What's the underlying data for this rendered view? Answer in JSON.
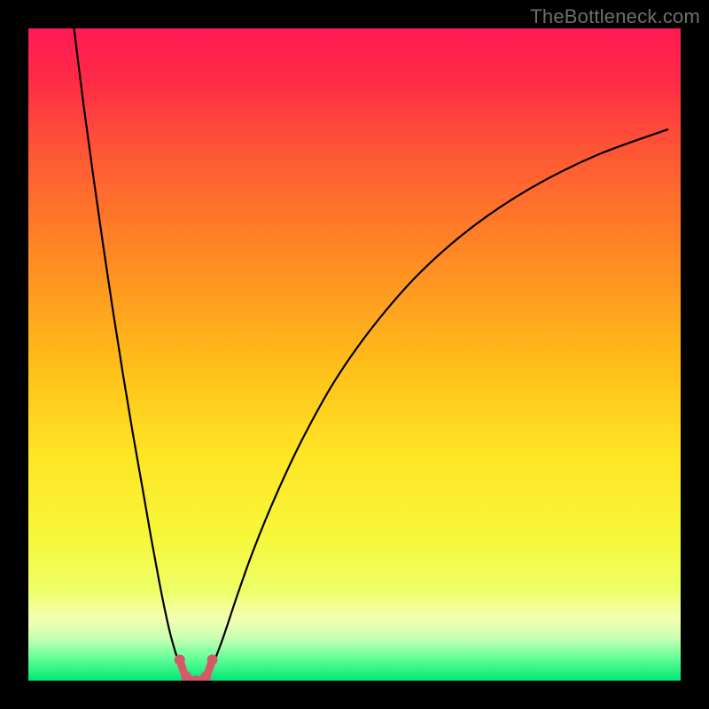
{
  "watermark": {
    "text": "TheBottleneck.com"
  },
  "chart_data": {
    "type": "line",
    "title": "",
    "xlabel": "",
    "ylabel": "",
    "xlim": [
      0,
      100
    ],
    "ylim": [
      0,
      100
    ],
    "grid": false,
    "legend": false,
    "background_gradient_stops": [
      {
        "offset": 0.0,
        "color": "#ff1a55"
      },
      {
        "offset": 0.08,
        "color": "#ff2b46"
      },
      {
        "offset": 0.2,
        "color": "#ff5a33"
      },
      {
        "offset": 0.35,
        "color": "#ff8a24"
      },
      {
        "offset": 0.5,
        "color": "#ffb91a"
      },
      {
        "offset": 0.65,
        "color": "#ffe423"
      },
      {
        "offset": 0.78,
        "color": "#f7f73a"
      },
      {
        "offset": 0.86,
        "color": "#eeff66"
      },
      {
        "offset": 0.905,
        "color": "#f4ffb0"
      },
      {
        "offset": 0.935,
        "color": "#c8ffb4"
      },
      {
        "offset": 0.965,
        "color": "#66ff99"
      },
      {
        "offset": 1.0,
        "color": "#00e874"
      }
    ],
    "series": [
      {
        "name": "left-branch",
        "stroke": "#000000",
        "stroke_width": 2.2,
        "x": [
          7.0,
          8.5,
          10.0,
          11.5,
          13.0,
          14.5,
          16.0,
          17.5,
          18.8,
          20.0,
          21.0,
          21.8,
          22.5,
          23.1,
          23.6,
          24.0
        ],
        "y": [
          100.0,
          88.0,
          77.0,
          66.5,
          56.5,
          47.0,
          38.0,
          29.5,
          22.0,
          15.5,
          10.5,
          7.0,
          4.5,
          2.8,
          1.6,
          0.9
        ]
      },
      {
        "name": "right-branch",
        "stroke": "#000000",
        "stroke_width": 2.2,
        "x": [
          27.5,
          28.5,
          30.0,
          32.0,
          34.5,
          38.0,
          42.0,
          47.0,
          53.0,
          60.0,
          68.0,
          77.0,
          87.0,
          98.0
        ],
        "y": [
          0.9,
          3.0,
          7.0,
          13.0,
          20.0,
          28.5,
          37.0,
          46.0,
          54.5,
          62.5,
          69.5,
          75.5,
          80.5,
          84.5
        ]
      },
      {
        "name": "bottom-u-marker",
        "stroke": "#d45a6a",
        "stroke_width": 9,
        "marker_radius": 6,
        "x": [
          23.2,
          24.2,
          25.7,
          27.2,
          28.2
        ],
        "y": [
          3.2,
          0.6,
          0.0,
          0.6,
          3.2
        ]
      }
    ]
  }
}
